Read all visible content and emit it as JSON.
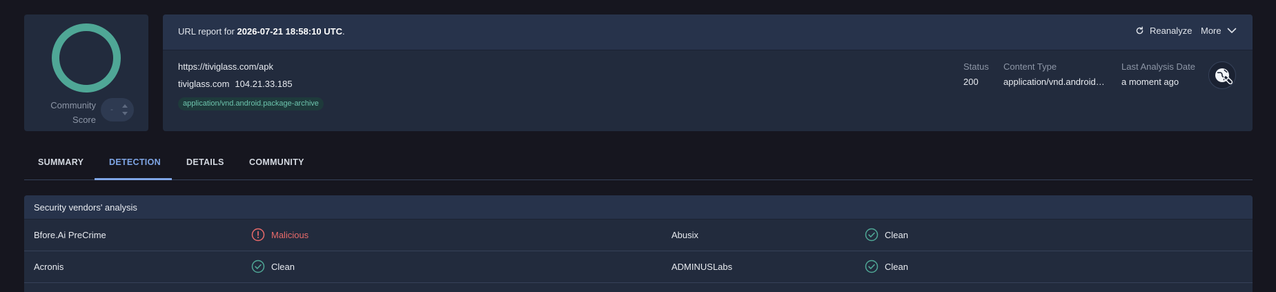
{
  "score": {
    "label": "Community Score",
    "stepper_value": "-"
  },
  "report": {
    "title_prefix": "URL report for ",
    "title_date": "2026-07-21 18:58:10 UTC",
    "title_suffix": ".",
    "reanalyze_label": "Reanalyze",
    "more_label": "More",
    "url": "https://tiviglass.com/apk",
    "host": "tiviglass.com",
    "ip": "104.21.33.185",
    "content_tag": "application/vnd.android.package-archive",
    "meta": [
      {
        "key": "Status",
        "value": "200"
      },
      {
        "key": "Content Type",
        "value": "application/vnd.android.package-archive"
      },
      {
        "key": "Last Analysis Date",
        "value": "a moment ago"
      }
    ],
    "action_icon": "globe-link-icon"
  },
  "tabs": [
    {
      "label": "SUMMARY",
      "active": false
    },
    {
      "label": "DETECTION",
      "active": true
    },
    {
      "label": "DETAILS",
      "active": false
    },
    {
      "label": "COMMUNITY",
      "active": false
    }
  ],
  "vendors": {
    "title": "Security vendors' analysis",
    "rows": [
      [
        {
          "name": "Bfore.Ai PreCrime",
          "result": "Malicious",
          "status": "malicious"
        },
        {
          "name": "Abusix",
          "result": "Clean",
          "status": "clean"
        }
      ],
      [
        {
          "name": "Acronis",
          "result": "Clean",
          "status": "clean"
        },
        {
          "name": "ADMINUSLabs",
          "result": "Clean",
          "status": "clean"
        }
      ]
    ]
  },
  "colors": {
    "accent": "#7fa6e6",
    "clean": "#4fa796",
    "malicious": "#e86a6a",
    "background": "#16161f",
    "card": "#222b3d"
  }
}
